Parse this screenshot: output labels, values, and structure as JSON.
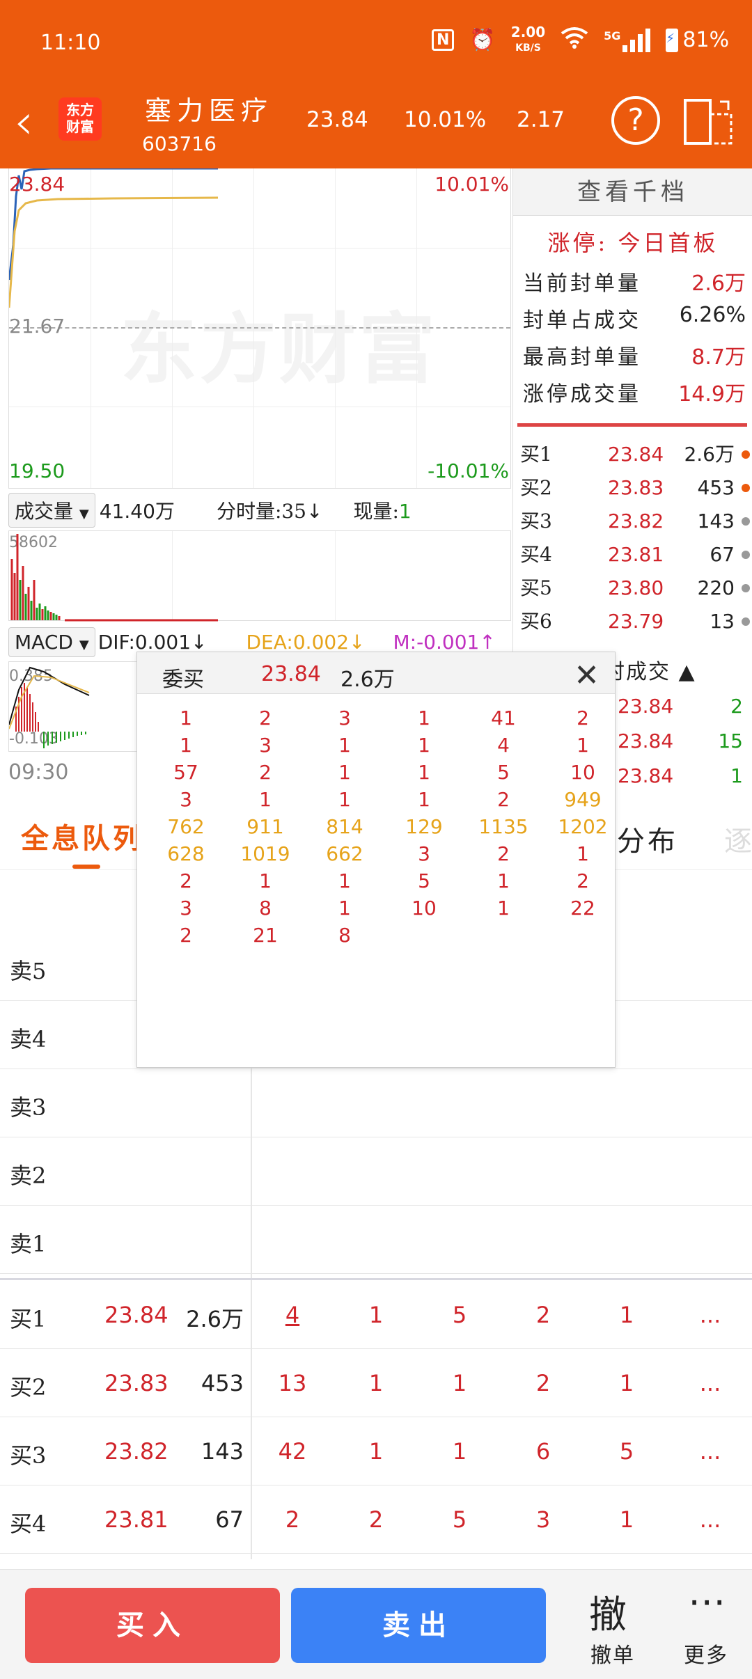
{
  "status": {
    "time": "11:10",
    "net_speed": "2.00",
    "net_unit": "KB/S",
    "signal": "5G",
    "battery": "81%"
  },
  "header": {
    "logo_line1": "东方",
    "logo_line2": "财富",
    "name": "塞力医疗",
    "code": "603716",
    "price": "23.84",
    "pct": "10.01%",
    "change": "2.17",
    "help": "?"
  },
  "chart": {
    "high": "23.84",
    "high_pct": "10.01%",
    "mid": "21.67",
    "low": "19.50",
    "low_pct": "-10.01%",
    "watermark": "东方财富"
  },
  "volume": {
    "label": "成交量",
    "value": "41.40万",
    "tick_label": "分时量:35",
    "tick_arrow": "↓",
    "now_label": "现量:",
    "now_value": "1",
    "max": "58602"
  },
  "macd": {
    "label": "MACD",
    "dif": "DIF:0.001",
    "dif_arrow": "↓",
    "dea": "DEA:0.002",
    "dea_arrow": "↓",
    "m": "M:-0.001",
    "m_arrow": "↑",
    "top": "0.385",
    "bottom": "-0.103"
  },
  "time_start": "09:30",
  "right_panel": {
    "ladder_button": "查看千档",
    "limit_title": "涨停: 今日首板",
    "limit_rows": [
      {
        "k": "当前封单量",
        "v": "2.6万",
        "color": "#d0242a"
      },
      {
        "k": "封单占成交",
        "v": "6.26%",
        "color": "#222222"
      },
      {
        "k": "最高封单量",
        "v": "8.7万",
        "color": "#d0242a"
      },
      {
        "k": "涨停成交量",
        "v": "14.9万",
        "color": "#d0242a"
      }
    ],
    "book": [
      {
        "l": "买1",
        "p": "23.84",
        "v": "2.6万",
        "dot": "#ec5a0d"
      },
      {
        "l": "买2",
        "p": "23.83",
        "v": "453",
        "dot": "#ec5a0d"
      },
      {
        "l": "买3",
        "p": "23.82",
        "v": "143",
        "dot": "#999999"
      },
      {
        "l": "买4",
        "p": "23.81",
        "v": "67",
        "dot": "#999999"
      },
      {
        "l": "买5",
        "p": "23.80",
        "v": "220",
        "dot": "#999999"
      },
      {
        "l": "买6",
        "p": "23.79",
        "v": "13",
        "dot": "#999999"
      }
    ],
    "trades_head": "时成交 ▲",
    "trades": [
      {
        "p": "23.84",
        "v": "2"
      },
      {
        "p": "23.84",
        "v": "15"
      },
      {
        "p": "23.84",
        "v": "1"
      }
    ]
  },
  "tabs": {
    "active": "全息队列",
    "distribution": "分布",
    "more": "逐"
  },
  "queue": {
    "sell": [
      "卖5",
      "卖4",
      "卖3",
      "卖2",
      "卖1"
    ],
    "buy": [
      {
        "l": "买1",
        "p": "23.84",
        "v": "2.6万",
        "cells": [
          "4",
          "1",
          "5",
          "2",
          "1",
          "..."
        ]
      },
      {
        "l": "买2",
        "p": "23.83",
        "v": "453",
        "cells": [
          "13",
          "1",
          "1",
          "2",
          "1",
          "..."
        ]
      },
      {
        "l": "买3",
        "p": "23.82",
        "v": "143",
        "cells": [
          "42",
          "1",
          "1",
          "6",
          "5",
          "..."
        ]
      },
      {
        "l": "买4",
        "p": "23.81",
        "v": "67",
        "cells": [
          "2",
          "2",
          "5",
          "3",
          "1",
          "..."
        ]
      }
    ]
  },
  "popup": {
    "title": "委买",
    "price": "23.84",
    "volume": "2.6万",
    "close": "✕",
    "rows": [
      [
        {
          "v": "1",
          "c": "r"
        },
        {
          "v": "2",
          "c": "r"
        },
        {
          "v": "3",
          "c": "r"
        },
        {
          "v": "1",
          "c": "r"
        },
        {
          "v": "41",
          "c": "r"
        },
        {
          "v": "2",
          "c": "r"
        }
      ],
      [
        {
          "v": "1",
          "c": "r"
        },
        {
          "v": "3",
          "c": "r"
        },
        {
          "v": "1",
          "c": "r"
        },
        {
          "v": "1",
          "c": "r"
        },
        {
          "v": "4",
          "c": "r"
        },
        {
          "v": "1",
          "c": "r"
        }
      ],
      [
        {
          "v": "57",
          "c": "r"
        },
        {
          "v": "2",
          "c": "r"
        },
        {
          "v": "1",
          "c": "r"
        },
        {
          "v": "1",
          "c": "r"
        },
        {
          "v": "5",
          "c": "r"
        },
        {
          "v": "10",
          "c": "r"
        }
      ],
      [
        {
          "v": "3",
          "c": "r"
        },
        {
          "v": "1",
          "c": "r"
        },
        {
          "v": "1",
          "c": "r"
        },
        {
          "v": "1",
          "c": "r"
        },
        {
          "v": "2",
          "c": "r"
        },
        {
          "v": "949",
          "c": "o"
        }
      ],
      [
        {
          "v": "762",
          "c": "o"
        },
        {
          "v": "911",
          "c": "o"
        },
        {
          "v": "814",
          "c": "o"
        },
        {
          "v": "129",
          "c": "o"
        },
        {
          "v": "1135",
          "c": "o"
        },
        {
          "v": "1202",
          "c": "o"
        }
      ],
      [
        {
          "v": "628",
          "c": "o"
        },
        {
          "v": "1019",
          "c": "o"
        },
        {
          "v": "662",
          "c": "o"
        },
        {
          "v": "3",
          "c": "r"
        },
        {
          "v": "2",
          "c": "r"
        },
        {
          "v": "1",
          "c": "r"
        }
      ],
      [
        {
          "v": "2",
          "c": "r"
        },
        {
          "v": "1",
          "c": "r"
        },
        {
          "v": "1",
          "c": "r"
        },
        {
          "v": "5",
          "c": "r"
        },
        {
          "v": "1",
          "c": "r"
        },
        {
          "v": "2",
          "c": "r"
        }
      ],
      [
        {
          "v": "3",
          "c": "r"
        },
        {
          "v": "8",
          "c": "r"
        },
        {
          "v": "1",
          "c": "r"
        },
        {
          "v": "10",
          "c": "r"
        },
        {
          "v": "1",
          "c": "r"
        },
        {
          "v": "22",
          "c": "r"
        }
      ],
      [
        {
          "v": "2",
          "c": "r"
        },
        {
          "v": "21",
          "c": "r"
        },
        {
          "v": "8",
          "c": "r"
        }
      ]
    ]
  },
  "bottom": {
    "buy": "买入",
    "sell": "卖出",
    "cancel_icon": "撤",
    "cancel": "撤单",
    "more_icon": "⋯",
    "more": "更多"
  },
  "colors": {
    "brand": "#ec5a0d",
    "up": "#d0242a",
    "down": "#1c9a1c",
    "buy_btn": "#ec5350",
    "sell_btn": "#3b82f6"
  }
}
